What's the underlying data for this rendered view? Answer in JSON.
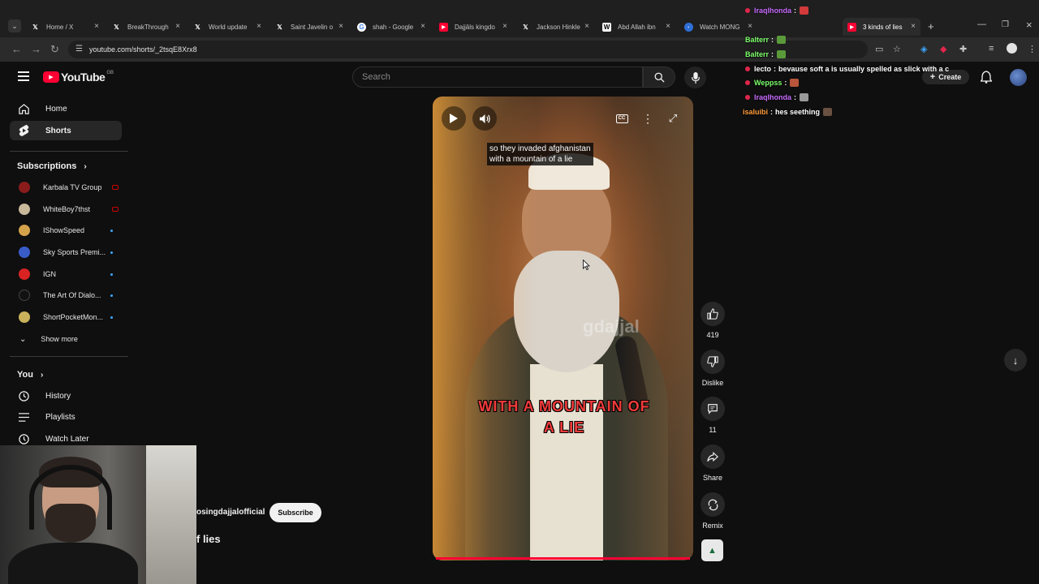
{
  "browser": {
    "tabs": [
      {
        "title": "Home / X",
        "icon": "x-icon"
      },
      {
        "title": "BreakThrough",
        "icon": "x-icon"
      },
      {
        "title": "World update",
        "icon": "x-icon"
      },
      {
        "title": "Saint Javelin o",
        "icon": "x-icon"
      },
      {
        "title": "shah - Google",
        "icon": "google-icon"
      },
      {
        "title": "Dajjāls kingdo",
        "icon": "youtube-icon"
      },
      {
        "title": "Jackson Hinkle",
        "icon": "x-icon"
      },
      {
        "title": "Abd Allah ibn",
        "icon": "wikipedia-icon"
      },
      {
        "title": "Watch MONG",
        "icon": "globe-icon"
      },
      {
        "title": "3 kinds of lies",
        "icon": "youtube-icon"
      }
    ],
    "url": "youtube.com/shorts/_2tsqE8Xrx8"
  },
  "youtube": {
    "logo_text": "YouTube",
    "region": "GB",
    "search_placeholder": "Search",
    "create_label": "Create"
  },
  "sidebar": {
    "nav": [
      {
        "label": "Home",
        "icon": "home-icon"
      },
      {
        "label": "Shorts",
        "icon": "shorts-icon"
      }
    ],
    "subscriptions_header": "Subscriptions",
    "subscriptions": [
      {
        "label": "Karbala TV Group",
        "status": "live",
        "color": "#8a1c1c"
      },
      {
        "label": "WhiteBoy7thst",
        "status": "live",
        "color": "#c8b89a"
      },
      {
        "label": "IShowSpeed",
        "status": "new",
        "color": "#d4a24a"
      },
      {
        "label": "Sky Sports Premi...",
        "status": "new",
        "color": "#3a5cc9"
      },
      {
        "label": "IGN",
        "status": "new",
        "color": "#d92323"
      },
      {
        "label": "The Art Of Dialo...",
        "status": "new",
        "color": "#111111"
      },
      {
        "label": "ShortPocketMon...",
        "status": "new",
        "color": "#c9b25a"
      }
    ],
    "show_more": "Show more",
    "you_header": "You",
    "you_items": [
      {
        "label": "History",
        "icon": "history-icon"
      },
      {
        "label": "Playlists",
        "icon": "playlists-icon"
      },
      {
        "label": "Watch Later",
        "icon": "watch-later-icon"
      }
    ]
  },
  "video": {
    "caption_line1": "so they invaded afghanistan",
    "caption_line2": "with a mountain of a lie",
    "watermark": "gdajjal",
    "burned_sub_line1": "WITH A MOUNTAIN OF",
    "burned_sub_line2": "A LIE",
    "channel": "osingdajjalofficial",
    "subscribe_label": "Subscribe",
    "title_fragment": "f lies"
  },
  "actions": {
    "likes": "419",
    "dislike": "Dislike",
    "comments": "11",
    "share": "Share",
    "remix": "Remix"
  },
  "chat": [
    {
      "user": "Iraqlhonda",
      "text": "",
      "user_color": "#c86cff",
      "badge": true
    },
    {
      "user": "Balterr",
      "text": "",
      "user_color": "#7cff6b",
      "badge": false
    },
    {
      "user": "Balterr",
      "text": "",
      "user_color": "#7cff6b",
      "badge": false
    },
    {
      "user": "lecto",
      "text": "bevause soft a is usually spelled as slick with a c",
      "user_color": "#ffffff",
      "badge": true
    },
    {
      "user": "Weppss",
      "text": "",
      "user_color": "#7cff6b",
      "badge": true
    },
    {
      "user": "Iraqlhonda",
      "text": "",
      "user_color": "#c86cff",
      "badge": true
    },
    {
      "user": "isaluibi",
      "text": "hes seething",
      "user_color": "#ff9c3a",
      "badge": false
    }
  ],
  "colors": {
    "accent": "#ff0033",
    "bg": "#0f0f0f"
  }
}
